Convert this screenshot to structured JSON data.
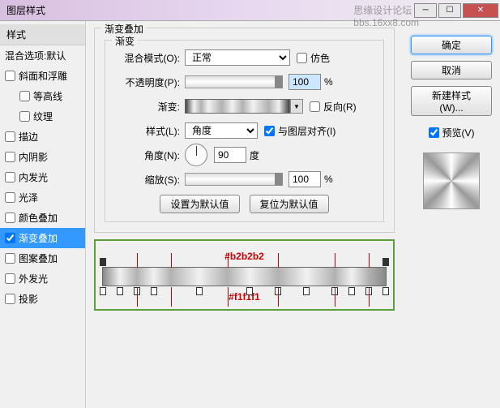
{
  "titlebar": {
    "title": "图层样式"
  },
  "watermark": {
    "line1": "思缘设计论坛",
    "line2": "bbs.16xx8.com"
  },
  "sidebar": {
    "header": "样式",
    "blend_header": "混合选项:默认",
    "items": [
      {
        "label": "斜面和浮雕",
        "checked": false,
        "sub": false
      },
      {
        "label": "等高线",
        "checked": false,
        "sub": true
      },
      {
        "label": "纹理",
        "checked": false,
        "sub": true
      },
      {
        "label": "描边",
        "checked": false,
        "sub": false
      },
      {
        "label": "内阴影",
        "checked": false,
        "sub": false
      },
      {
        "label": "内发光",
        "checked": false,
        "sub": false
      },
      {
        "label": "光泽",
        "checked": false,
        "sub": false
      },
      {
        "label": "颜色叠加",
        "checked": false,
        "sub": false
      },
      {
        "label": "渐变叠加",
        "checked": true,
        "sub": false,
        "selected": true
      },
      {
        "label": "图案叠加",
        "checked": false,
        "sub": false
      },
      {
        "label": "外发光",
        "checked": false,
        "sub": false
      },
      {
        "label": "投影",
        "checked": false,
        "sub": false
      }
    ]
  },
  "main": {
    "group_title": "渐变叠加",
    "inner_title": "渐变",
    "blend_mode": {
      "label": "混合模式(O):",
      "value": "正常",
      "dither": "仿色"
    },
    "opacity": {
      "label": "不透明度(P):",
      "value": "100",
      "unit": "%"
    },
    "gradient": {
      "label": "渐变:",
      "reverse": "反向(R)"
    },
    "style": {
      "label": "样式(L):",
      "value": "角度",
      "align": "与图层对齐(I)"
    },
    "angle": {
      "label": "角度(N):",
      "value": "90",
      "unit": "度"
    },
    "scale": {
      "label": "缩放(S):",
      "value": "100",
      "unit": "%"
    },
    "buttons": {
      "default": "设置为默认值",
      "reset": "复位为默认值"
    }
  },
  "editor": {
    "top_label": "#b2b2b2",
    "bot_label": "#f1f1f1",
    "top_stops_pct": [
      0,
      100
    ],
    "bot_stops_pct": [
      0,
      6,
      12,
      18,
      34,
      52,
      62,
      72,
      82,
      88,
      94,
      100
    ],
    "red_verticals_pct": [
      12,
      24,
      44,
      62,
      82,
      94
    ]
  },
  "right": {
    "ok": "确定",
    "cancel": "取消",
    "new_style": "新建样式(W)...",
    "preview": "预览(V)"
  }
}
